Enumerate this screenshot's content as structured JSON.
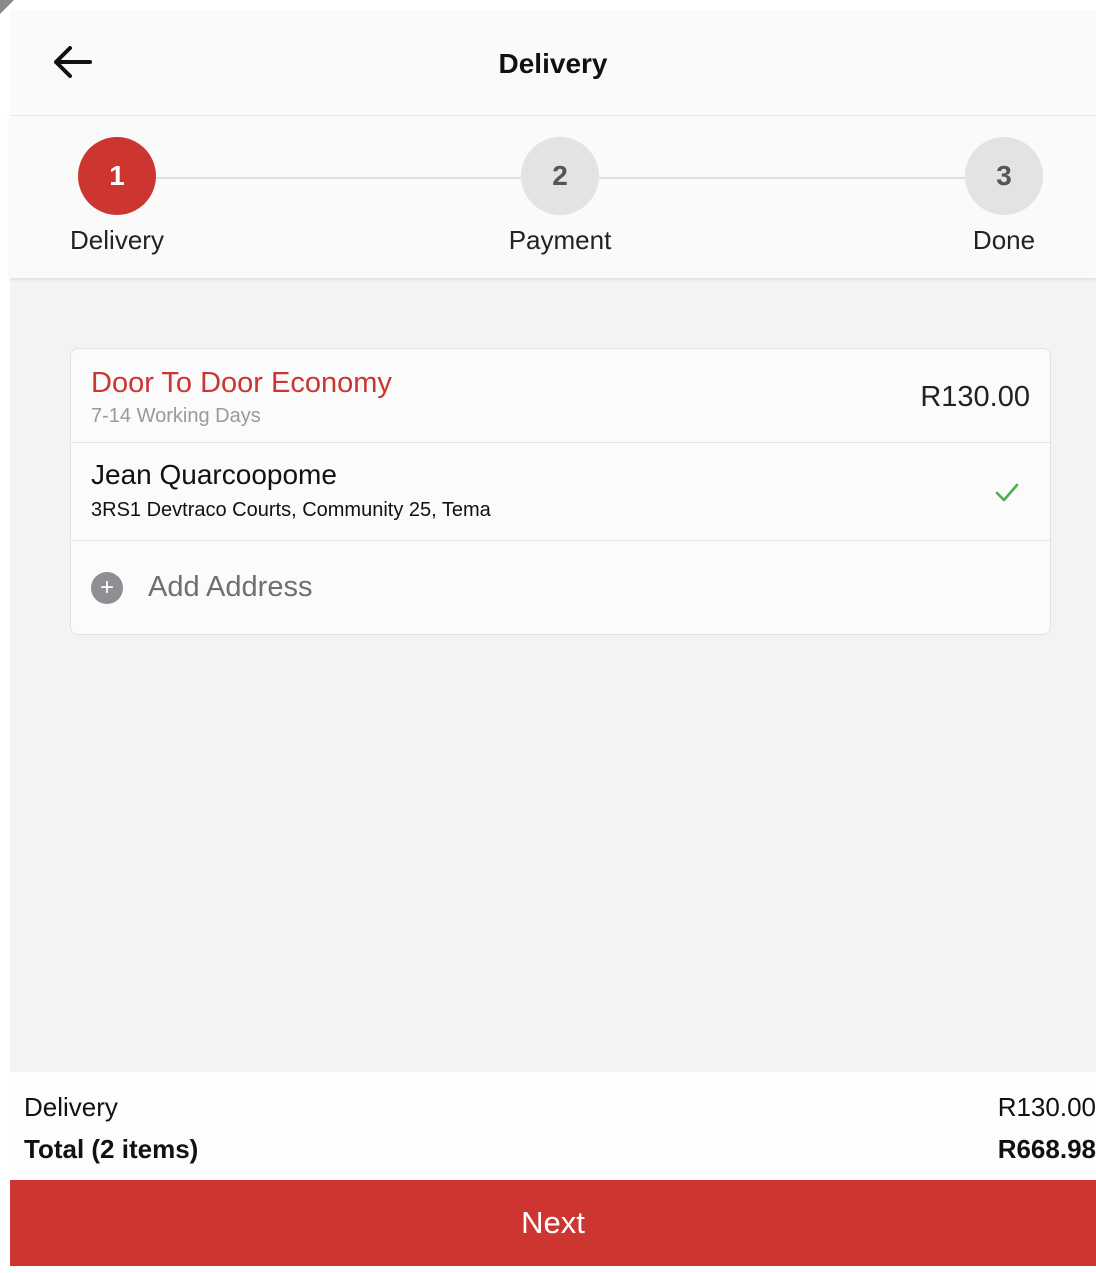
{
  "header": {
    "title": "Delivery"
  },
  "steps": [
    {
      "number": "1",
      "label": "Delivery"
    },
    {
      "number": "2",
      "label": "Payment"
    },
    {
      "number": "3",
      "label": "Done"
    }
  ],
  "shipping": {
    "name": "Door To Door Economy",
    "eta": "7-14 Working Days",
    "price": "R130.00"
  },
  "address": {
    "name": "Jean Quarcoopome",
    "line": "3RS1 Devtraco Courts, Community 25, Tema",
    "selected": true
  },
  "add_address": {
    "label": "Add Address"
  },
  "summary": {
    "delivery_label": "Delivery",
    "delivery_value": "R130.00",
    "total_label": "Total (2 items)",
    "total_value": "R668.98"
  },
  "next_button": {
    "label": "Next"
  },
  "colors": {
    "accent": "#cc3530",
    "check": "#4caf50",
    "inactive_step": "#e3e3e6"
  }
}
